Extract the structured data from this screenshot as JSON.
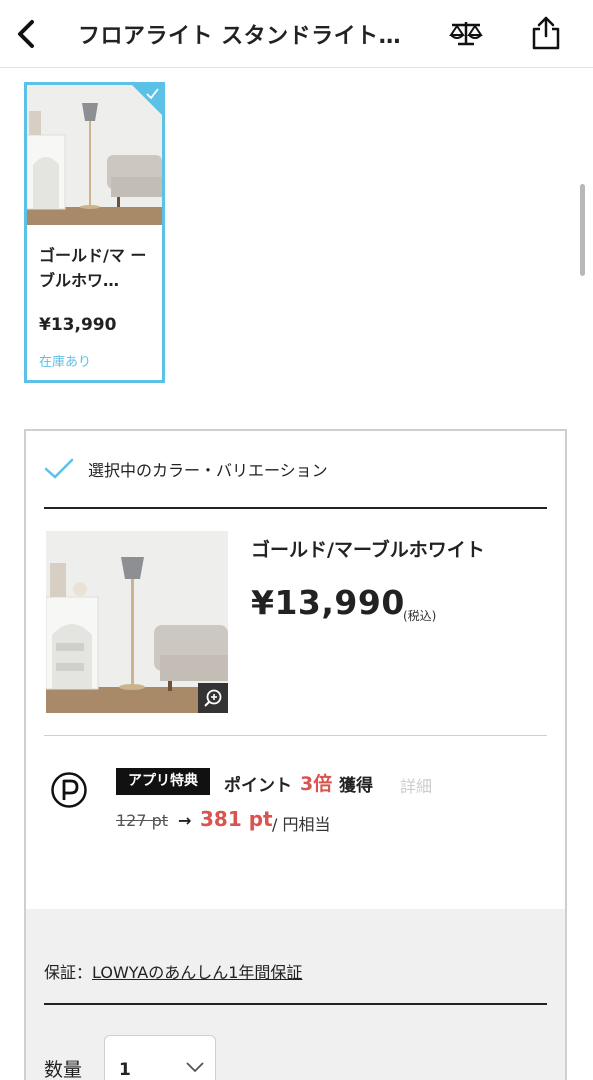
{
  "header": {
    "title": "フロアライト スタンドライト…",
    "back_icon": "chevron-left-icon",
    "compare_icon": "scale-icon",
    "share_icon": "share-icon"
  },
  "variation_card": {
    "name": "ゴールド/マーブルホワイト",
    "name_display": "ゴールド/マ ーブルホワ…",
    "price": "¥13,990",
    "stock": "在庫あり",
    "selected": true
  },
  "selected_panel": {
    "label": "選択中のカラー・バリエーション",
    "product_name": "ゴールド/マーブルホワイト",
    "price": "¥13,990",
    "tax_note": "(税込)"
  },
  "points": {
    "badge": "アプリ特典",
    "label": "ポイント",
    "multiplier": "3倍",
    "get": "獲得",
    "detail_link": "詳細",
    "old_points": "127 pt",
    "arrow": "→",
    "new_points": "381 pt",
    "yen_note": "/ 円相当"
  },
  "warranty": {
    "prefix": "保証：",
    "link": "LOWYAのあんしん1年間保証"
  },
  "quantity": {
    "label": "数量",
    "value": "1"
  },
  "colors": {
    "accent": "#5cc1e6",
    "points_red": "#d9534f"
  }
}
